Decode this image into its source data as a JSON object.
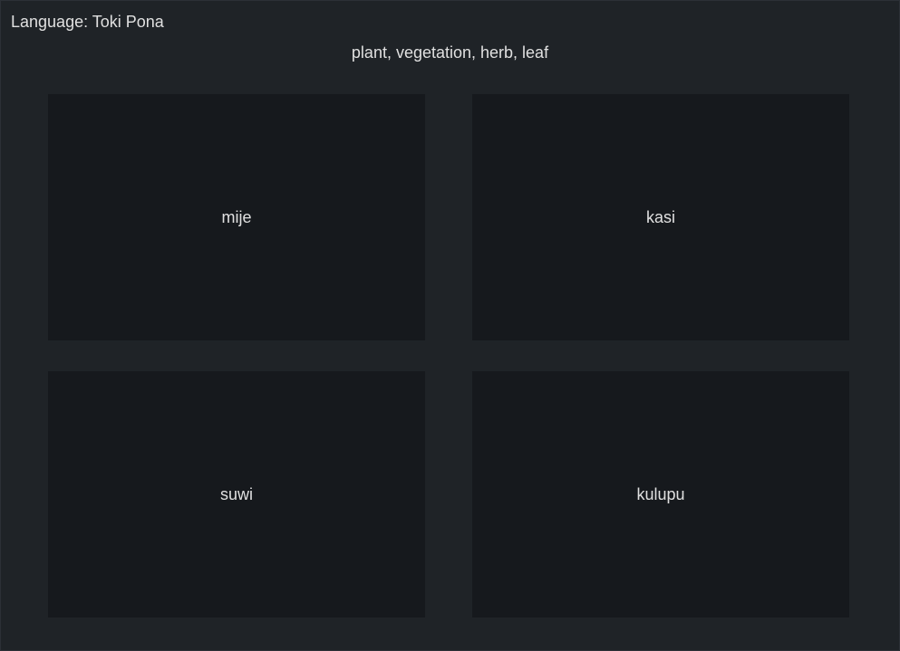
{
  "language_label": "Language: Toki Pona",
  "prompt": "plant, vegetation, herb, leaf",
  "options": [
    "mije",
    "kasi",
    "suwi",
    "kulupu"
  ]
}
